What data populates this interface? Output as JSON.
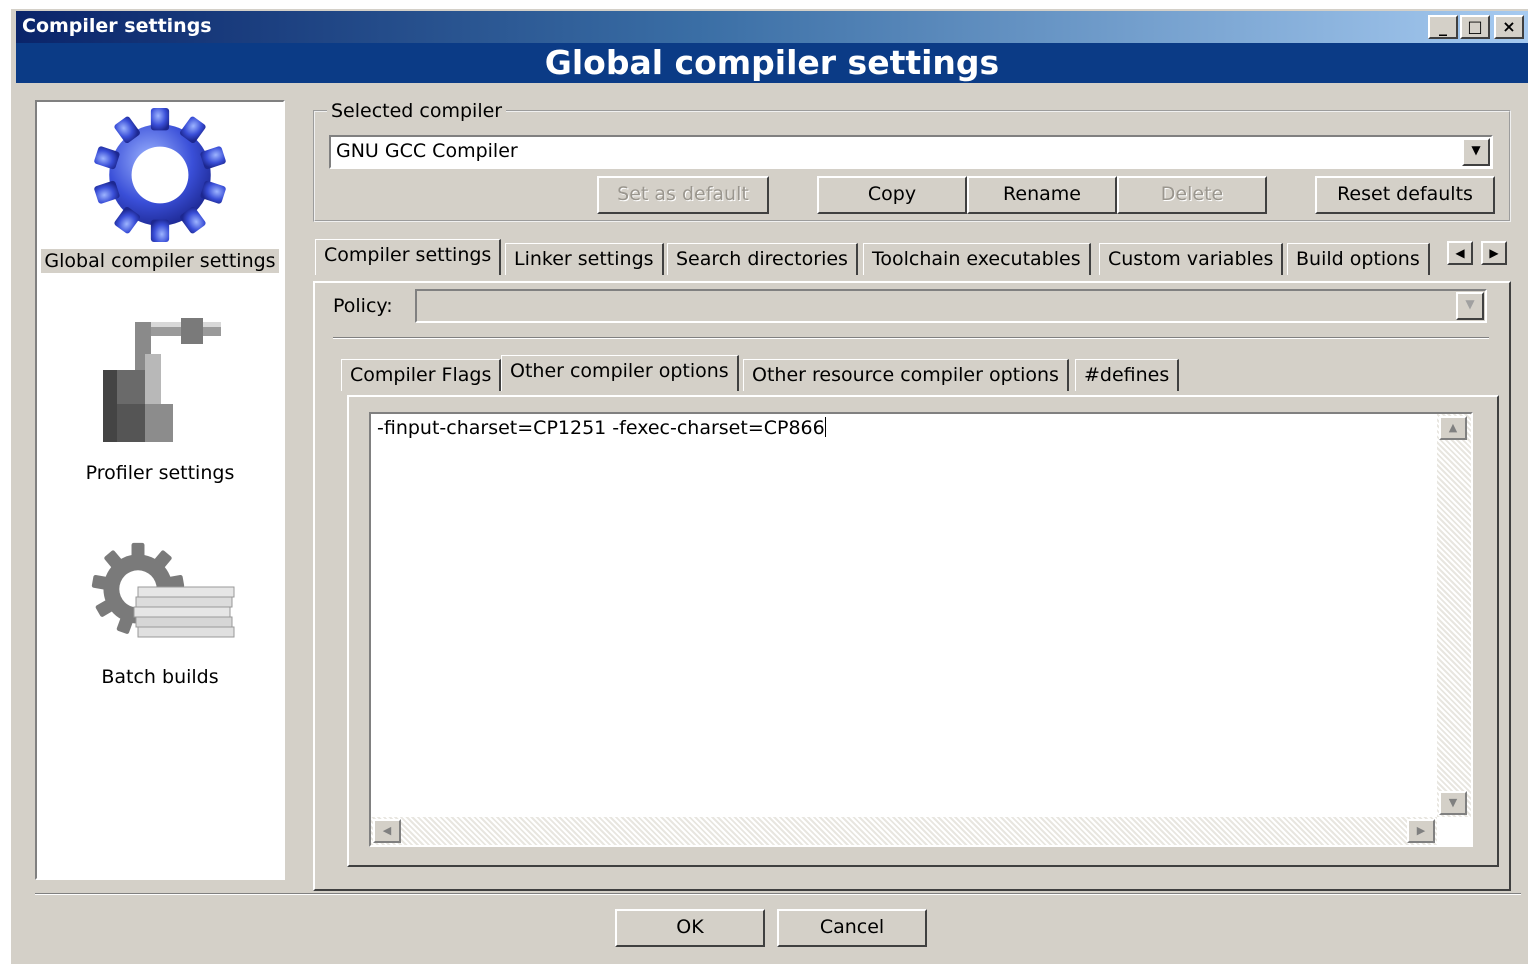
{
  "window": {
    "title": "Compiler settings",
    "header": "Global compiler settings",
    "controls": {
      "minimize": "_",
      "maximize": "□",
      "close": "×"
    }
  },
  "sidebar": {
    "items": [
      {
        "label": "Global compiler settings",
        "icon": "gear-icon",
        "selected": true
      },
      {
        "label": "Profiler settings",
        "icon": "caliper-icon",
        "selected": false
      },
      {
        "label": "Batch builds",
        "icon": "batch-gear-icon",
        "selected": false
      }
    ]
  },
  "compiler_group": {
    "legend": "Selected compiler",
    "selected": "GNU GCC Compiler",
    "buttons": {
      "set_default": "Set as default",
      "copy": "Copy",
      "rename": "Rename",
      "delete": "Delete",
      "reset_defaults": "Reset defaults"
    }
  },
  "tabs": [
    {
      "label": "Compiler settings",
      "active": true
    },
    {
      "label": "Linker settings",
      "active": false
    },
    {
      "label": "Search directories",
      "active": false
    },
    {
      "label": "Toolchain executables",
      "active": false
    },
    {
      "label": "Custom variables",
      "active": false
    },
    {
      "label": "Build options",
      "active": false
    }
  ],
  "policy": {
    "label": "Policy:",
    "value": ""
  },
  "subtabs": [
    {
      "label": "Compiler Flags",
      "active": false
    },
    {
      "label": "Other compiler options",
      "active": true
    },
    {
      "label": "Other resource compiler options",
      "active": false
    },
    {
      "label": "#defines",
      "active": false
    }
  ],
  "editor": {
    "text": "-finput-charset=CP1251 -fexec-charset=CP866"
  },
  "footer": {
    "ok": "OK",
    "cancel": "Cancel"
  }
}
